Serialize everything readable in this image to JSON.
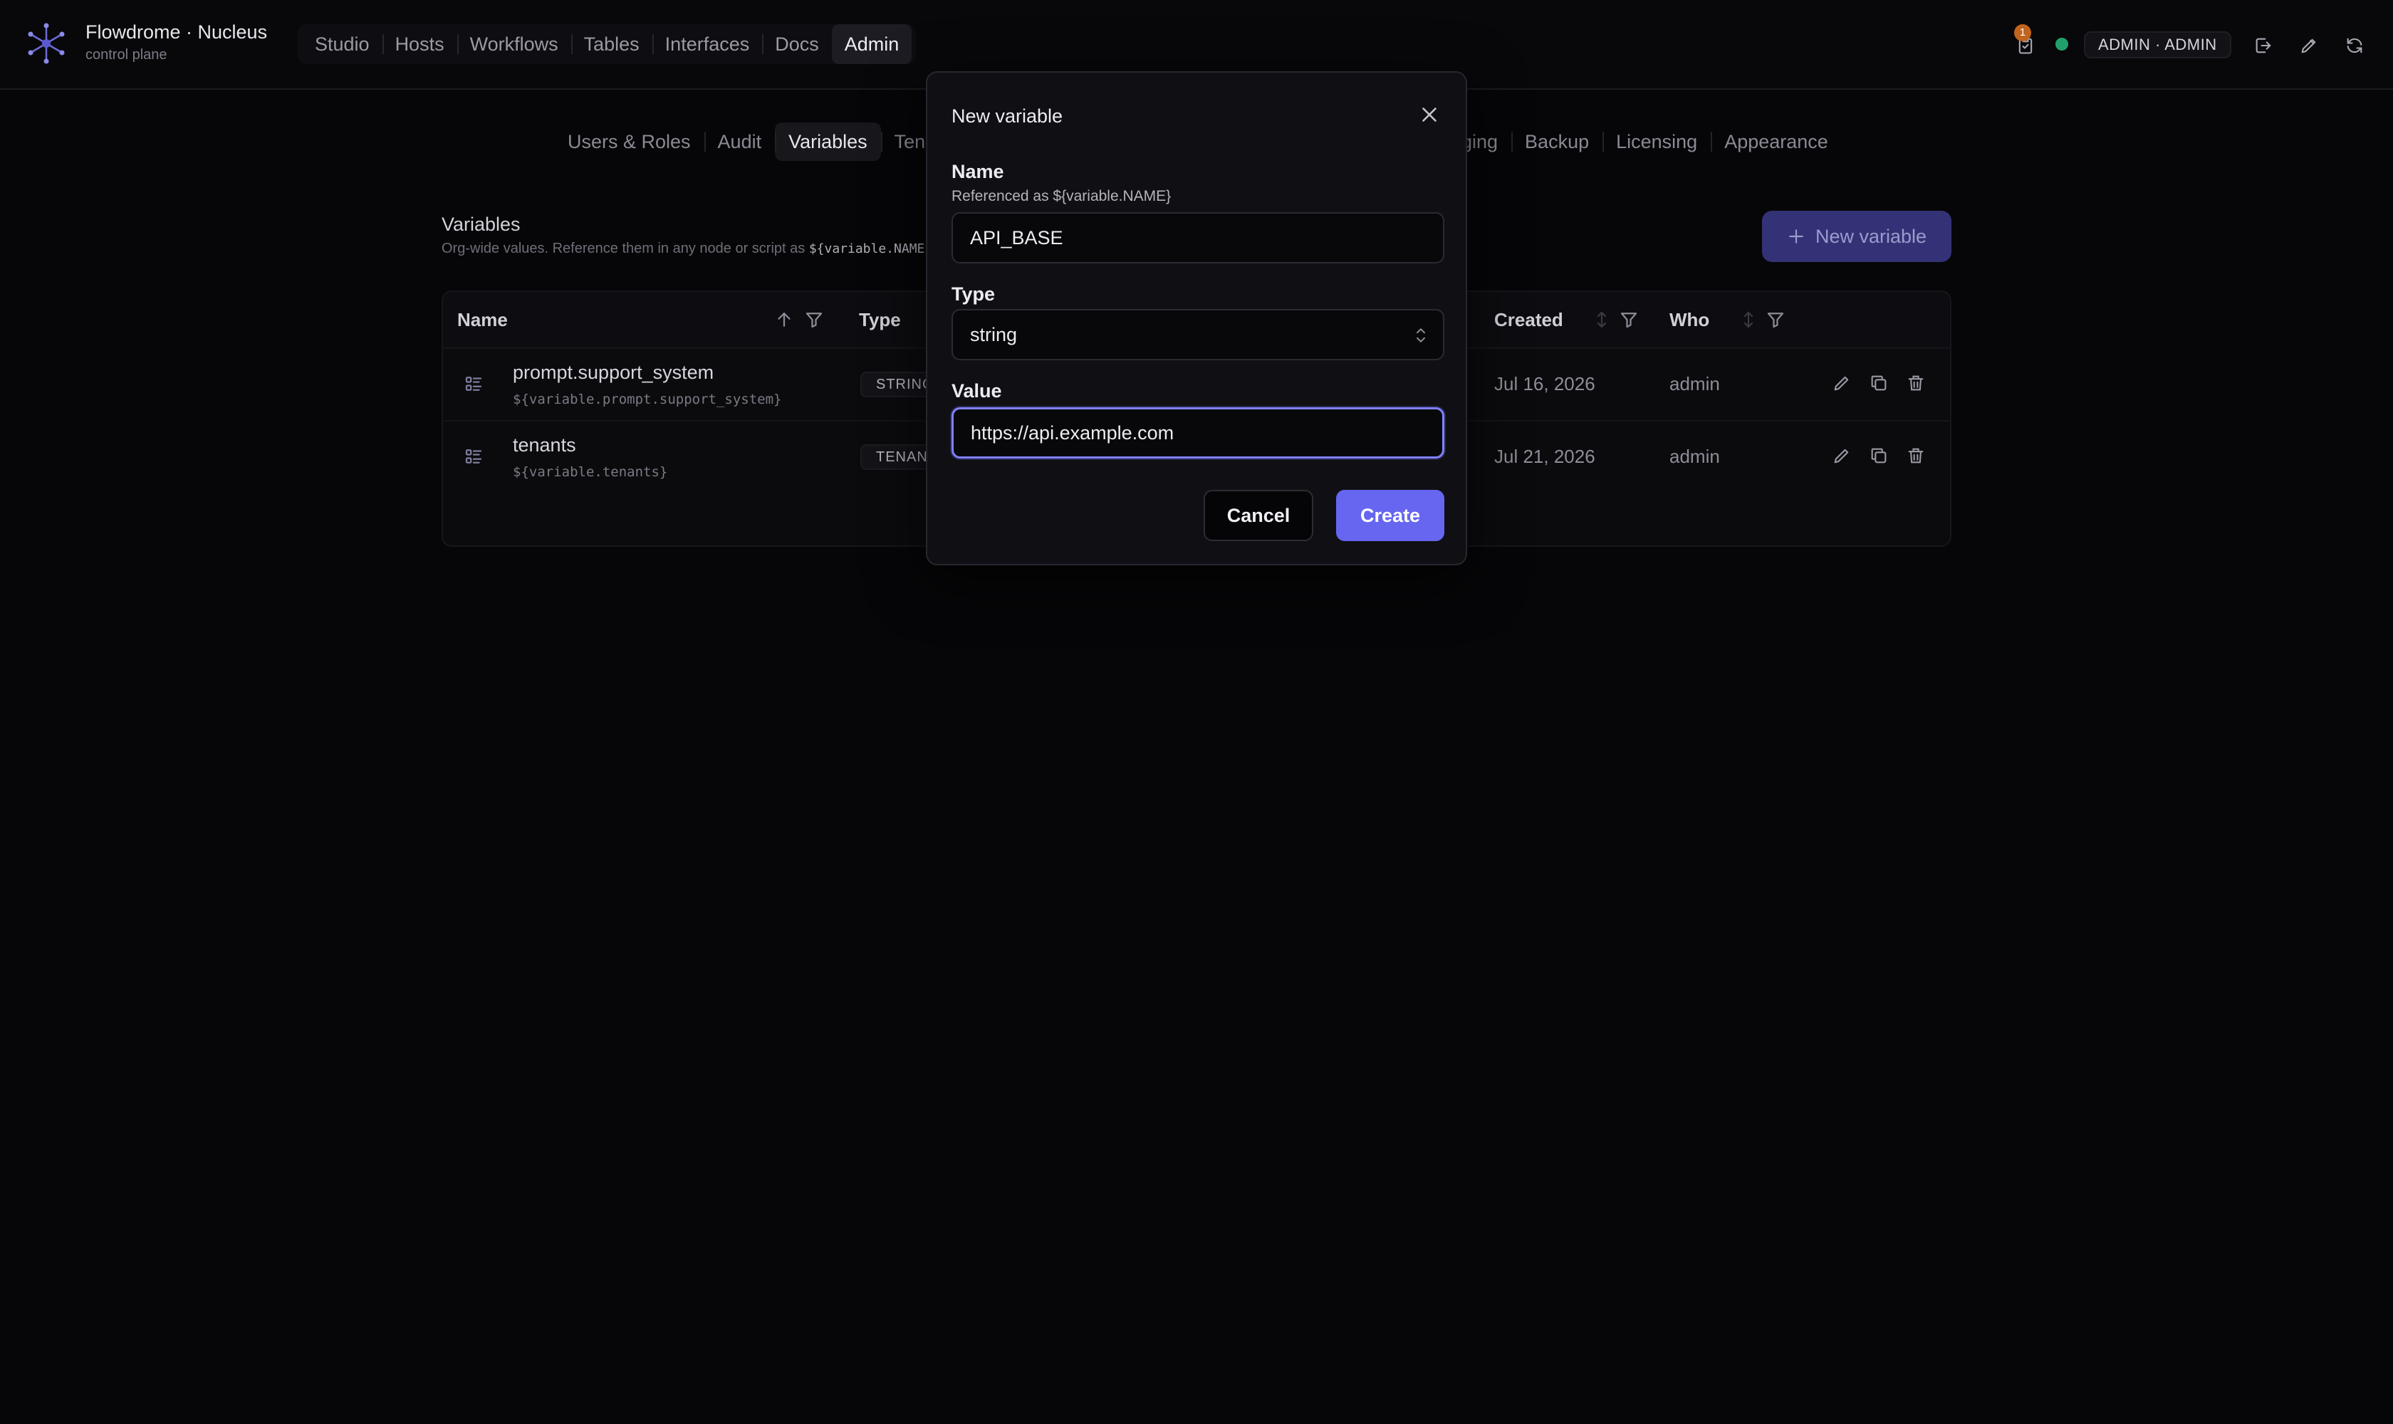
{
  "app": {
    "title": "Flowdrome · Nucleus",
    "subtitle": "control plane"
  },
  "main_nav": [
    {
      "label": "Studio"
    },
    {
      "label": "Hosts"
    },
    {
      "label": "Workflows"
    },
    {
      "label": "Tables"
    },
    {
      "label": "Interfaces"
    },
    {
      "label": "Docs"
    },
    {
      "label": "Admin",
      "active": true
    }
  ],
  "header": {
    "notification_count": "1",
    "user_label": "ADMIN · ADMIN"
  },
  "admin_tabs": {
    "users_roles": "Users & Roles",
    "audit": "Audit",
    "variables": "Variables",
    "tenants": "Tena",
    "logging": "ging",
    "backup": "Backup",
    "licensing": "Licensing",
    "appearance": "Appearance"
  },
  "page": {
    "title": "Variables",
    "description": "Org-wide values. Reference them in any node or script as ",
    "description_code": "${variable.NAME}",
    "new_button": "New variable"
  },
  "table": {
    "columns": {
      "name": "Name",
      "type": "Type",
      "created": "Created",
      "who": "Who"
    },
    "rows": [
      {
        "name": "prompt.support_system",
        "ref": "${variable.prompt.support_system}",
        "type": "STRING",
        "created": "Jul 16, 2026",
        "who": "admin"
      },
      {
        "name": "tenants",
        "ref": "${variable.tenants}",
        "type": "TENAN",
        "created": "Jul 21, 2026",
        "who": "admin"
      }
    ]
  },
  "modal": {
    "title": "New variable",
    "name_label": "Name",
    "name_hint": "Referenced as ${variable.NAME}",
    "name_value": "API_BASE",
    "type_label": "Type",
    "type_value": "string",
    "value_label": "Value",
    "value_value": "https://api.example.com",
    "cancel": "Cancel",
    "create": "Create"
  },
  "colors": {
    "accent": "#6666f0",
    "status_ok": "#22a06b",
    "badge": "#c0641e"
  }
}
